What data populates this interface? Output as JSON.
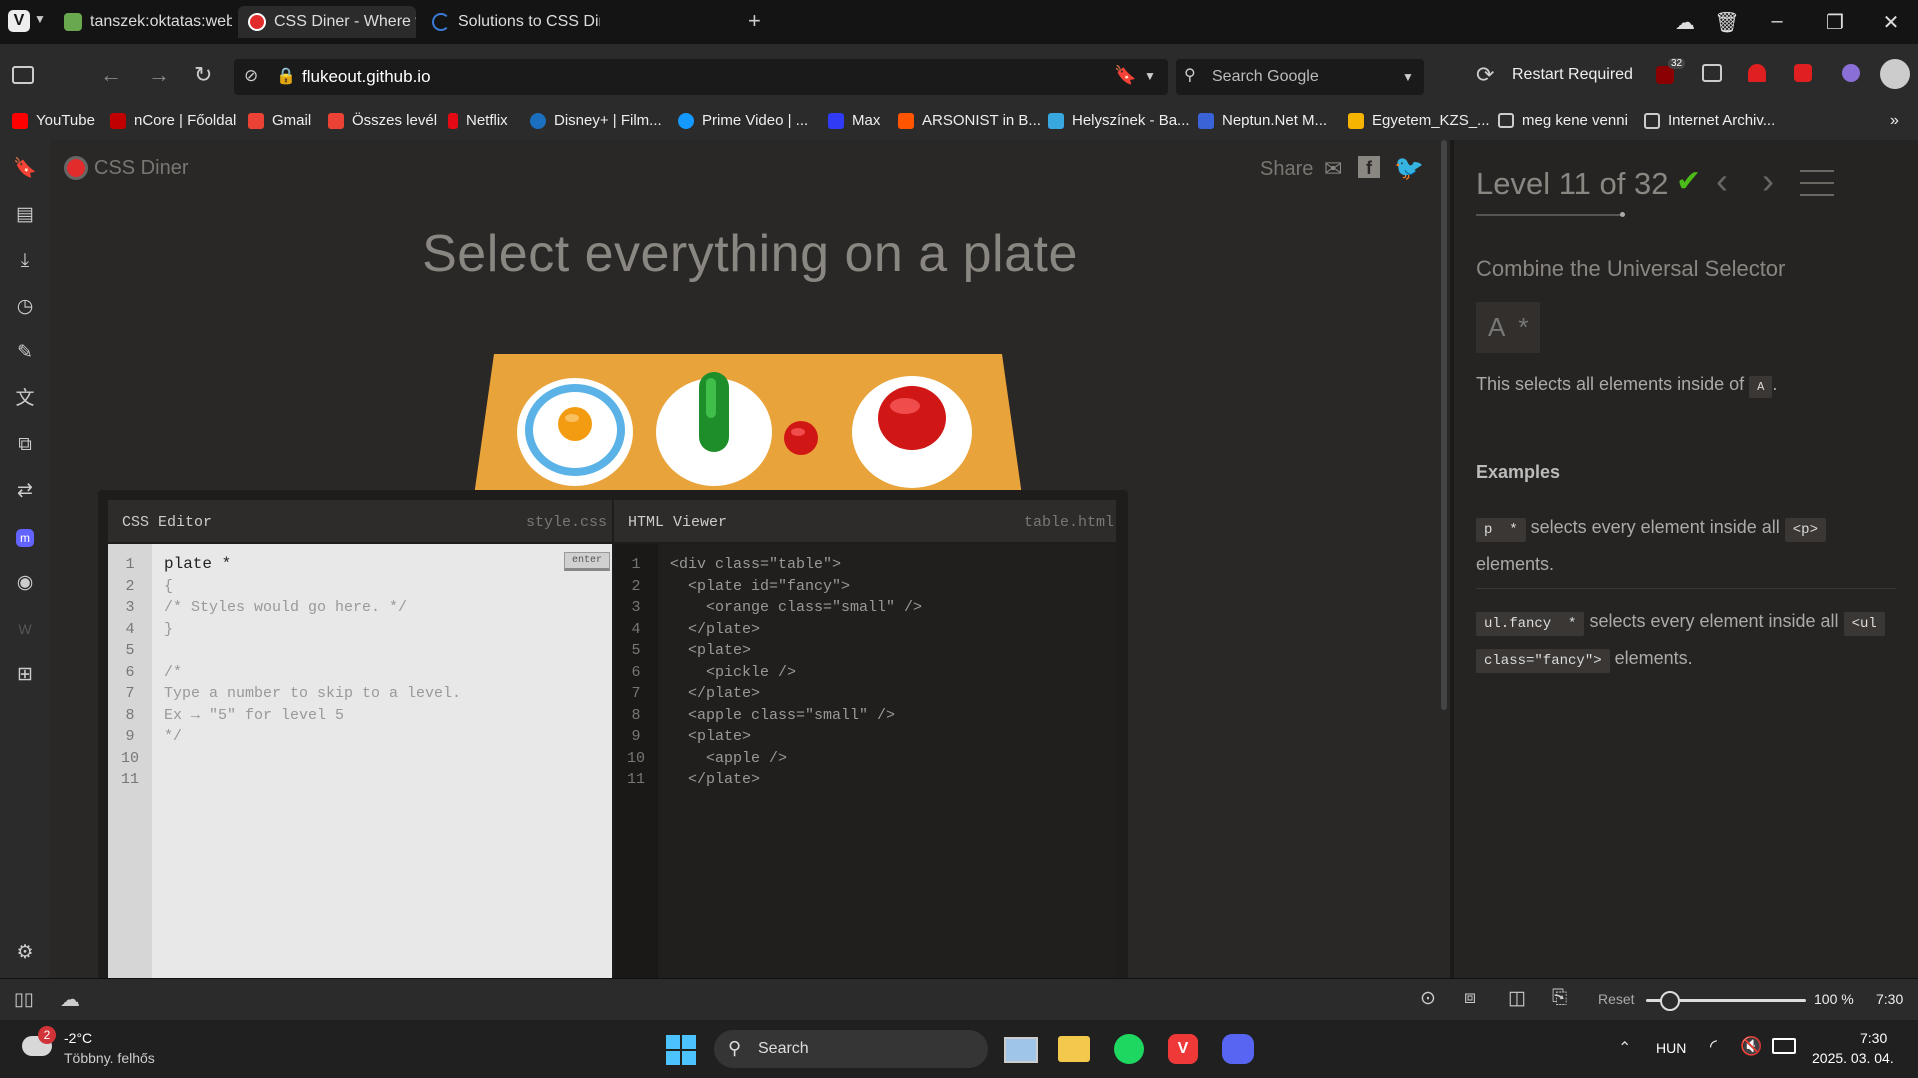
{
  "browser": {
    "tabs": [
      {
        "title": "tanszek:oktatas:web_techno",
        "active": false
      },
      {
        "title": "CSS Diner - Where we feast",
        "active": true
      },
      {
        "title": "Solutions to CSS Diner | anc",
        "active": false
      }
    ],
    "url_host": "flukeout.github.io",
    "search_placeholder": "Search Google",
    "restart_label": "Restart Required",
    "ublock_badge": "32",
    "bookmarks": [
      {
        "label": "YouTube",
        "color": "#ff0000"
      },
      {
        "label": "nCore | Főoldal",
        "color": "#c00000"
      },
      {
        "label": "Gmail",
        "color": "#ea4335"
      },
      {
        "label": "Összes levél",
        "color": "#ea4335"
      },
      {
        "label": "Netflix",
        "color": "#e50914"
      },
      {
        "label": "Disney+ | Film...",
        "color": "#1b6fbf"
      },
      {
        "label": "Prime Video | ...",
        "color": "#1399ff"
      },
      {
        "label": "Max",
        "color": "#2f3bf5"
      },
      {
        "label": "ARSONIST in B...",
        "color": "#ff5500"
      },
      {
        "label": "Helyszínek - Ba...",
        "color": "#39a7e0"
      },
      {
        "label": "Neptun.Net M...",
        "color": "#3a63d8"
      },
      {
        "label": "Egyetem_KZS_...",
        "color": "#f4b400"
      },
      {
        "label": "meg kene venni",
        "color": "#cccccc"
      },
      {
        "label": "Internet Archiv...",
        "color": "#cccccc"
      }
    ],
    "zoom_reset": "Reset",
    "zoom_level": 100,
    "zoom_label": "100 %",
    "status_time": "7:30"
  },
  "diner": {
    "logo": "CSS Diner",
    "share": "Share",
    "instruction": "Select everything on a plate",
    "css_editor_title": "CSS Editor",
    "css_file": "style.css",
    "html_viewer_title": "HTML Viewer",
    "html_file": "table.html",
    "enter_label": "enter",
    "css_lines": [
      {
        "n": "1",
        "text": "plate *"
      },
      {
        "n": "2",
        "text": "{"
      },
      {
        "n": "3",
        "text": "/* Styles would go here. */"
      },
      {
        "n": "4",
        "text": "}"
      },
      {
        "n": "5",
        "text": ""
      },
      {
        "n": "6",
        "text": "/*"
      },
      {
        "n": "7",
        "text": "Type a number to skip to a level."
      },
      {
        "n": "8",
        "text": "Ex → \"5\" for level 5"
      },
      {
        "n": "9",
        "text": "*/"
      },
      {
        "n": "10",
        "text": ""
      },
      {
        "n": "11",
        "text": ""
      }
    ],
    "html_lines": [
      {
        "n": "1",
        "text": "<div class=\"table\">"
      },
      {
        "n": "2",
        "text": "  <plate id=\"fancy\">"
      },
      {
        "n": "3",
        "text": "    <orange class=\"small\" />"
      },
      {
        "n": "4",
        "text": "  </plate>"
      },
      {
        "n": "5",
        "text": "  <plate>"
      },
      {
        "n": "6",
        "text": "    <pickle />"
      },
      {
        "n": "7",
        "text": "  </plate>"
      },
      {
        "n": "8",
        "text": "  <apple class=\"small\" />"
      },
      {
        "n": "9",
        "text": "  <plate>"
      },
      {
        "n": "10",
        "text": "    <apple />"
      },
      {
        "n": "11",
        "text": "  </plate>"
      }
    ],
    "level": {
      "title": "Level 11 of 32",
      "current": 11,
      "total": 32,
      "subtitle": "Combine the Universal Selector",
      "syntax": "A  *",
      "desc_prefix": "This selects all elements inside of",
      "desc_code": "A",
      "desc_suffix": ".",
      "examples_title": "Examples",
      "ex1_code": "p  *",
      "ex1_text": "selects every element inside all",
      "ex1_code2": "<p>",
      "ex1_text2": "elements.",
      "ex2_code": "ul.fancy  *",
      "ex2_text": "selects every element inside all",
      "ex2_code2a": "<ul",
      "ex2_code2b": "class=\"fancy\">",
      "ex2_text2": "elements."
    }
  },
  "taskbar": {
    "weather_temp": "-2°C",
    "weather_desc": "Többny. felhős",
    "weather_badge": "2",
    "search_label": "Search",
    "lang": "HUN",
    "time": "7:30",
    "date": "2025. 03. 04."
  },
  "colors": {
    "accent_red": "#e22c2c",
    "check_green": "#4cbb17",
    "table_orange": "#e8a33a"
  }
}
